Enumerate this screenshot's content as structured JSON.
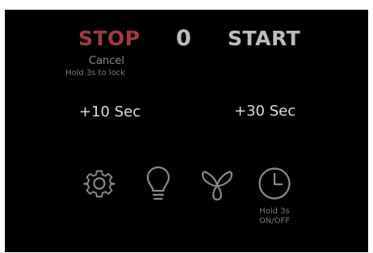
{
  "controls": {
    "stop_label": "STOP",
    "start_label": "START",
    "counter_value": "0",
    "cancel_label": "Cancel",
    "lock_hint": "Hold 3s to lock",
    "add_10_label": "+10 Sec",
    "add_30_label": "+30 Sec"
  },
  "icons": {
    "settings": "gear-icon",
    "light": "bulb-icon",
    "fan": "fan-icon",
    "timer": "clock-icon"
  },
  "timer_hint": {
    "line1": "Hold 3s",
    "line2": "ON/OFF"
  },
  "colors": {
    "background": "#000000",
    "stop_accent": "#a13a40",
    "primary_text": "#bdbdbd",
    "secondary_text": "#8a8a8a"
  }
}
